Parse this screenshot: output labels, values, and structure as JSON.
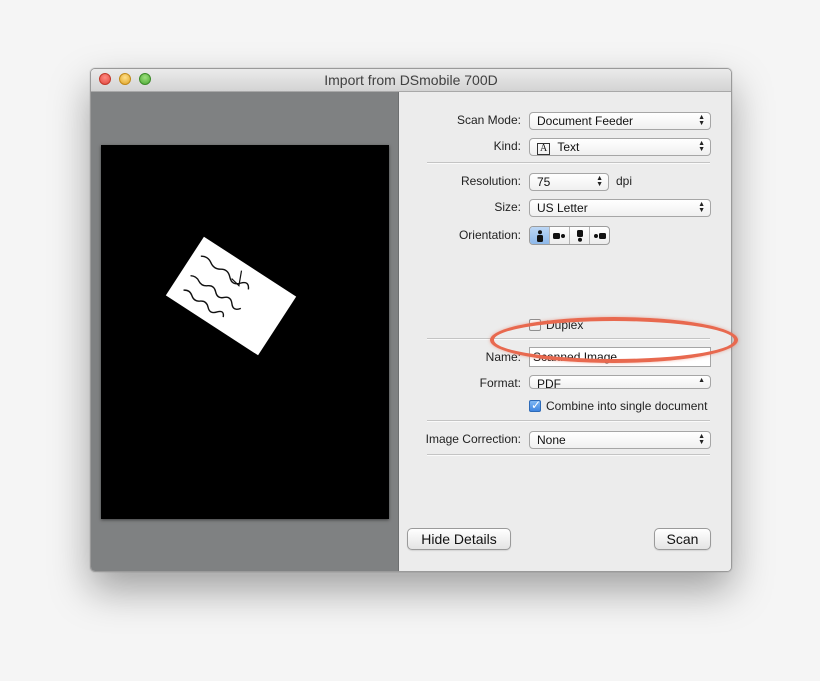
{
  "window": {
    "title": "Import from DSmobile 700D"
  },
  "settings": {
    "scan_mode": {
      "label": "Scan Mode:",
      "value": "Document Feeder"
    },
    "kind": {
      "label": "Kind:",
      "value": "Text",
      "icon_glyph": "A"
    },
    "resolution": {
      "label": "Resolution:",
      "value": "75",
      "unit": "dpi"
    },
    "size": {
      "label": "Size:",
      "value": "US Letter"
    },
    "orientation": {
      "label": "Orientation:",
      "selected_index": 0,
      "options": [
        "portrait",
        "rotate-left",
        "upside-down",
        "rotate-right"
      ]
    },
    "duplex": {
      "label": "Duplex",
      "checked": false
    },
    "name": {
      "label": "Name:",
      "value": "Scanned Image"
    },
    "format": {
      "label": "Format:",
      "value": "PDF"
    },
    "combine": {
      "label": "Combine into single document",
      "checked": true
    },
    "image_correction": {
      "label": "Image Correction:",
      "value": "None"
    }
  },
  "preview": {
    "card_lines": [
      "Thank you.",
      "A",
      "Anne this one more :)"
    ]
  },
  "buttons": {
    "hide_details": "Hide Details",
    "scan": "Scan"
  },
  "colors": {
    "highlight": "#e8694f",
    "preview_bg": "#7f8182",
    "selected_segment": "#8db8ea"
  }
}
